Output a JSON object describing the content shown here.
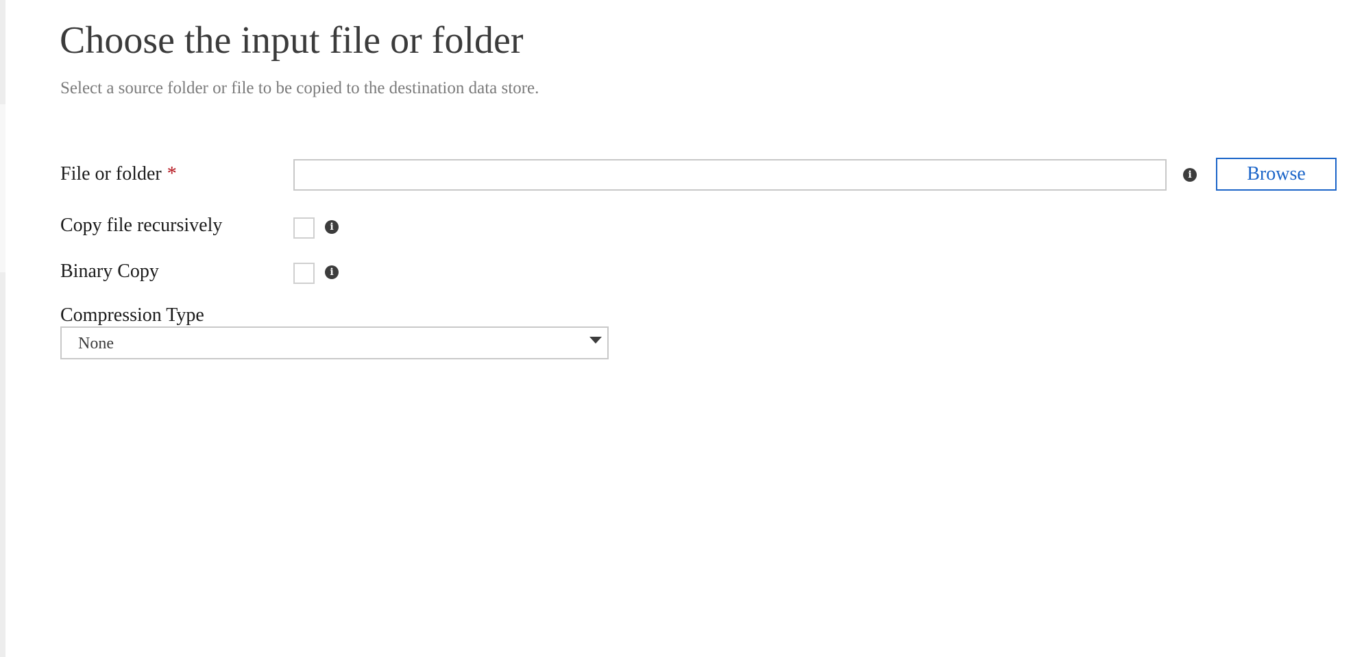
{
  "header": {
    "title": "Choose the input file or folder",
    "subtitle": "Select a source folder or file to be copied to the destination data store."
  },
  "form": {
    "file_or_folder": {
      "label": "File or folder",
      "required_mark": "*",
      "value": "",
      "placeholder": "",
      "info_icon": "info-icon"
    },
    "browse_label": "Browse",
    "copy_recursively": {
      "label": "Copy file recursively",
      "checked": false,
      "info_icon": "info-icon"
    },
    "binary_copy": {
      "label": "Binary Copy",
      "checked": false,
      "info_icon": "info-icon"
    },
    "compression_type": {
      "label": "Compression Type",
      "selected": "None",
      "icon": "chevron-down-icon"
    }
  },
  "colors": {
    "accent": "#1a64c8",
    "required": "#b4121b",
    "title": "#3b3b3b",
    "subtitle": "#7b7b7b",
    "border": "#c8c8c8"
  }
}
